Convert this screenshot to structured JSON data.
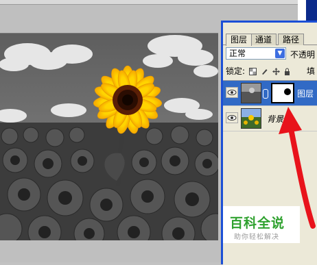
{
  "panel": {
    "tabs": [
      {
        "label": "图层"
      },
      {
        "label": "通道"
      },
      {
        "label": "路径"
      }
    ],
    "blend_mode": "正常",
    "opacity_label": "不透明",
    "lock_label": "锁定:",
    "fill_label": "填",
    "layers": [
      {
        "name": "图层",
        "selected": true,
        "icon": "eye-icon"
      },
      {
        "name": "背景",
        "selected": false,
        "icon": "eye-icon"
      }
    ]
  },
  "watermark": {
    "title": "百科全说",
    "subtitle": "助你轻松解决"
  },
  "colors": {
    "panel_accent": "#316ac5",
    "annotation_arrow": "#e8131b",
    "watermark_green": "#2ea12e"
  }
}
